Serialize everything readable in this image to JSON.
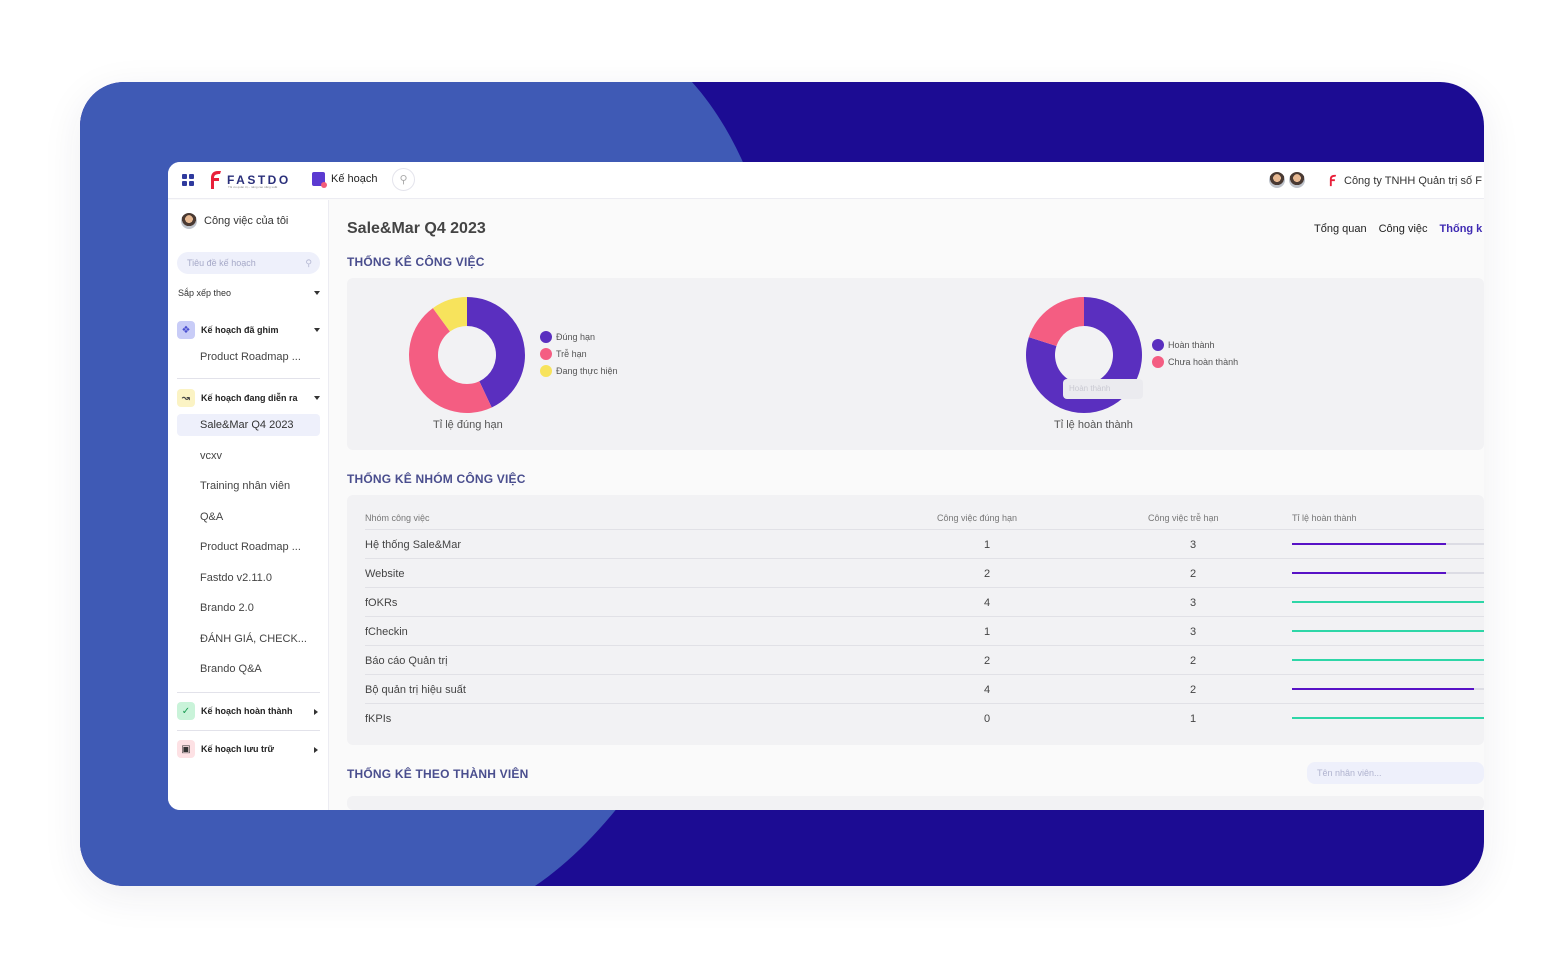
{
  "colors": {
    "frame_light": "#3f5ab5",
    "frame_dark": "#1c0c93",
    "accent": "#3f2bb3",
    "purple": "#5a2fbf",
    "pink": "#f45d82",
    "yellow": "#f7e35c",
    "teal": "#2ed6a7",
    "bar_purple": "#5812c6"
  },
  "topbar": {
    "logo_text": "FASTDO",
    "logo_sub": "Tối ưu quản trị – nâng cao năng suất",
    "plan_label": "Kế hoạch",
    "company": "Công ty TNHH Quản trị số F"
  },
  "sidebar": {
    "my_work": "Công việc của tôi",
    "search_placeholder": "Tiêu đề kế hoạch",
    "sort_label": "Sắp xếp theo",
    "pinned_title": "Kế hoạch đã ghim",
    "pinned_items": [
      "Product Roadmap ..."
    ],
    "ongoing_title": "Kế hoạch đang diễn ra",
    "ongoing_items": [
      "Sale&Mar Q4 2023",
      "vcxv",
      "Training nhân viên",
      "Q&A",
      "Product Roadmap ...",
      "Fastdo v2.11.0",
      "Brando 2.0",
      "ĐÁNH GIÁ, CHECK...",
      "Brando Q&A"
    ],
    "done_title": "Kế hoạch hoàn thành",
    "archive_title": "Kế hoạch lưu trữ"
  },
  "main": {
    "title": "Sale&Mar Q4 2023",
    "tabs": [
      "Tổng quan",
      "Công việc",
      "Thống k"
    ],
    "task_stats_title": "THỐNG KÊ CÔNG VIỆC",
    "group_stats_title": "THỐNG KÊ NHÓM CÔNG VIỆC",
    "member_stats_title": "THỐNG KÊ THEO THÀNH VIÊN",
    "member_search_placeholder": "Tên nhân viên...",
    "ghost_label": "Hoàn thành"
  },
  "chart_data": [
    {
      "type": "pie",
      "title": "Tỉ lệ đúng hạn",
      "labels": [
        "Đúng hạn",
        "Trễ hạn",
        "Đang thực hiện"
      ],
      "values": [
        43,
        47,
        10
      ],
      "colors": [
        "#5a2fbf",
        "#f45d82",
        "#f7e35c"
      ]
    },
    {
      "type": "pie",
      "title": "Tỉ lệ hoàn thành",
      "labels": [
        "Hoàn thành",
        "Chưa hoàn thành"
      ],
      "values": [
        80,
        20
      ],
      "colors": [
        "#5a2fbf",
        "#f45d82"
      ]
    }
  ],
  "table": {
    "headers": [
      "Nhóm công việc",
      "Công việc đúng hạn",
      "Công việc trễ hạn",
      "Tỉ lệ hoàn thành"
    ],
    "rows": [
      {
        "name": "Hệ thống Sale&Mar",
        "ontime": "1",
        "late": "3",
        "rate": 0.8,
        "color": "#5812c6"
      },
      {
        "name": "Website",
        "ontime": "2",
        "late": "2",
        "rate": 0.8,
        "color": "#5812c6"
      },
      {
        "name": "fOKRs",
        "ontime": "4",
        "late": "3",
        "rate": 1.0,
        "color": "#2ed6a7"
      },
      {
        "name": "fCheckin",
        "ontime": "1",
        "late": "3",
        "rate": 1.0,
        "color": "#2ed6a7"
      },
      {
        "name": "Báo cáo Quản trị",
        "ontime": "2",
        "late": "2",
        "rate": 1.0,
        "color": "#2ed6a7"
      },
      {
        "name": "Bộ quản trị hiệu suất",
        "ontime": "4",
        "late": "2",
        "rate": 0.95,
        "color": "#5812c6"
      },
      {
        "name": "fKPIs",
        "ontime": "0",
        "late": "1",
        "rate": 1.0,
        "color": "#2ed6a7"
      }
    ]
  }
}
